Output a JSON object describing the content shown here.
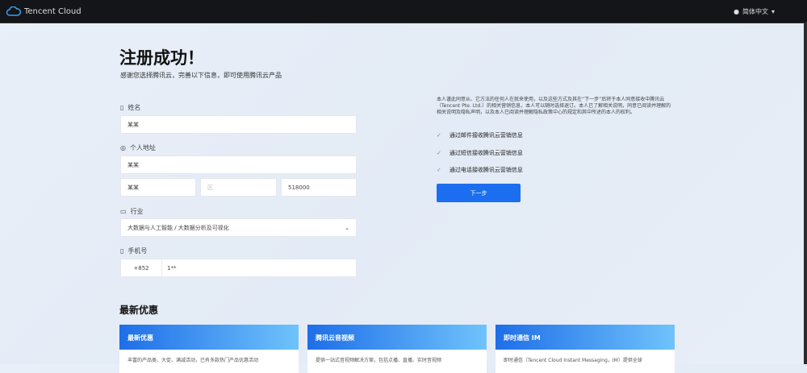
{
  "topbar": {
    "logo": "Tencent Cloud",
    "language": "简体中文"
  },
  "page": {
    "title": "注册成功！",
    "subtitle": "感谢您选择腾讯云，完善以下信息，即可使用腾讯云产品"
  },
  "form": {
    "name_label": "姓名",
    "name_value": "某某",
    "address_label": "个人地址",
    "address_line": "某某",
    "city": "某某",
    "district_placeholder": "区",
    "postcode": "518000",
    "industry_label": "行业",
    "industry_value": "大数据与人工智能 / 大数据分析及可视化",
    "phone_label": "手机号",
    "phone_code": "+852",
    "phone_value": "1**"
  },
  "consent": {
    "note": "本人谨此同意从、它方法的任何人在就来使用，以及这些方式及其在“下一步”后将于本人同意接收中腾讯云（Tencent Pte. Ltd.）的相关营销信息，本人可以随时选择退订。本人已了解相关说明，同意已阅读并理解的相关说明及隐私声明，以及本人已阅读并理解隐私政策中心的规定和其中所述的本人的权利。",
    "options": [
      "通过邮件接收腾讯云营销信息",
      "通过短信接收腾讯云营销信息",
      "通过电话接收腾讯云营销信息"
    ],
    "next_button": "下一步"
  },
  "offers": {
    "title": "最新优惠",
    "cards": [
      {
        "title": "最新优惠",
        "text": "丰富的产品类、大促、满减活动，已有多款热门产品优惠活动"
      },
      {
        "title": "腾讯云音视频",
        "text": "提供一站式音视频解决方案，包括点播、直播、实时音视频"
      },
      {
        "title": "即时通信 IM",
        "text": "即时通信（Tencent Cloud Instant Messaging，IM）提供全球"
      }
    ]
  }
}
